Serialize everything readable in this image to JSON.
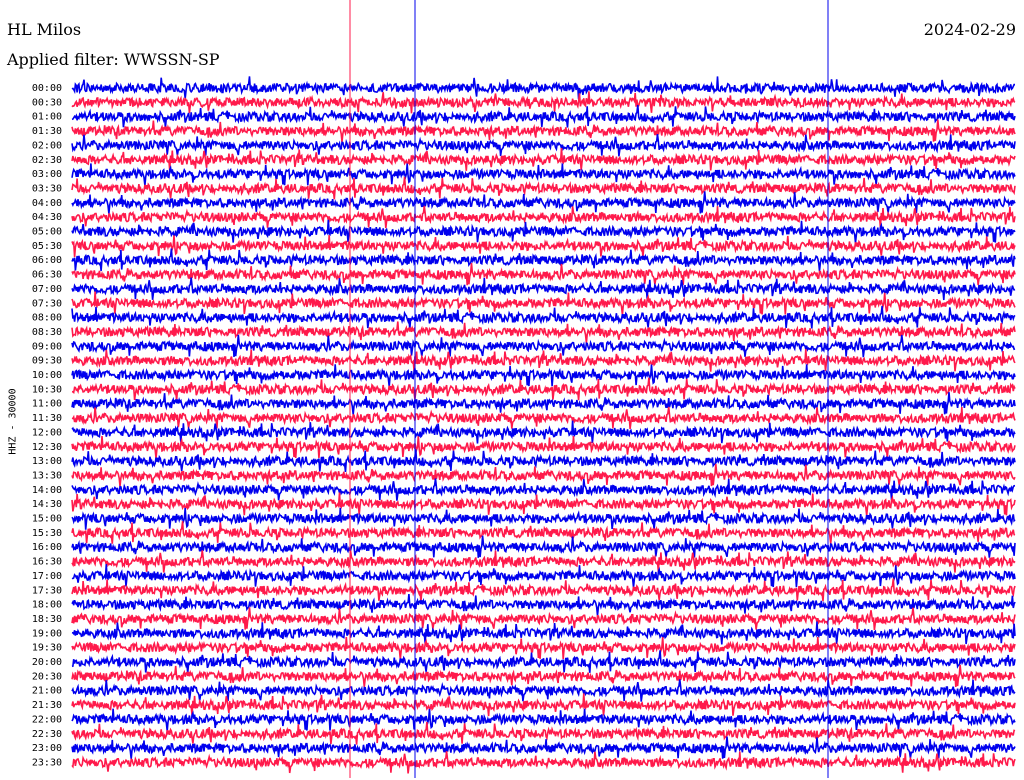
{
  "header": {
    "station": "HL Milos",
    "filter": "Applied filter: WWSSN-SP",
    "date": "2024-02-29"
  },
  "chart_data": {
    "type": "line",
    "title": "HL Milos",
    "ylabel": "HHZ - 30000",
    "row_labels": [
      "00:00",
      "00:30",
      "01:00",
      "01:30",
      "02:00",
      "02:30",
      "03:00",
      "03:30",
      "04:00",
      "04:30",
      "05:00",
      "05:30",
      "06:00",
      "06:30",
      "07:00",
      "07:30",
      "08:00",
      "08:30",
      "09:00",
      "09:30",
      "10:00",
      "10:30",
      "11:00",
      "11:30",
      "12:00",
      "12:30",
      "13:00",
      "13:30",
      "14:00",
      "14:30",
      "15:00",
      "15:30",
      "16:00",
      "16:30",
      "17:00",
      "17:30",
      "18:00",
      "18:30",
      "19:00",
      "19:30",
      "20:00",
      "20:30",
      "21:00",
      "21:30",
      "22:00",
      "22:30",
      "23:00",
      "23:30"
    ],
    "series_colors": [
      "#0000ee",
      "#ff1a4b"
    ]
  }
}
